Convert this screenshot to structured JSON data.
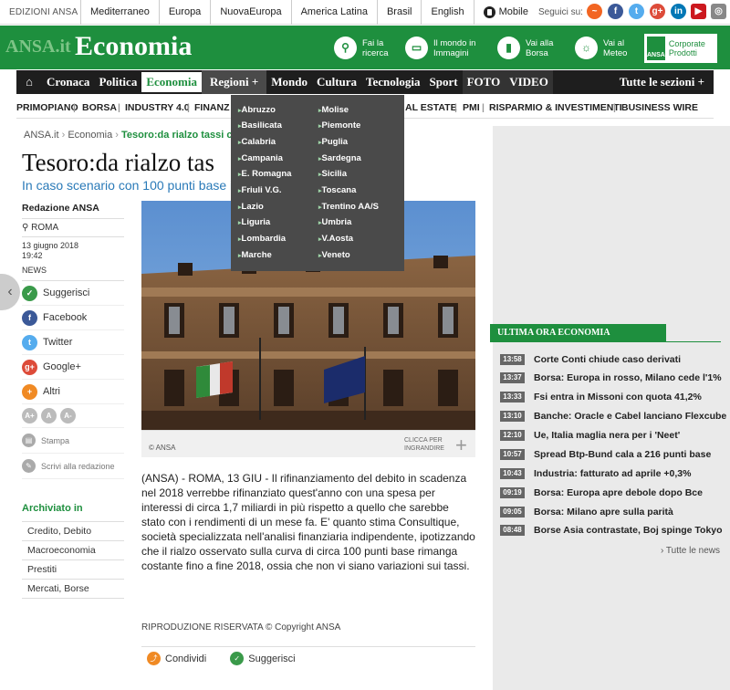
{
  "topbar": {
    "edition": "EDIZIONI ANSA",
    "links": [
      "Mediterraneo",
      "Europa",
      "NuovaEuropa",
      "America Latina",
      "Brasil",
      "English",
      "Mobile"
    ],
    "follow": "Seguici su:"
  },
  "header": {
    "logo_ansa": "ANSA.it",
    "section": "Economia",
    "buttons": [
      {
        "label": "Fai la ricerca",
        "icon": "search-icon"
      },
      {
        "label": "Il mondo in Immagini",
        "icon": "photo-icon"
      },
      {
        "label": "Vai alla Borsa",
        "icon": "chart-icon"
      },
      {
        "label": "Vai al Meteo",
        "icon": "weather-icon"
      }
    ],
    "corporate": "Corporate Prodotti",
    "corporate_logo": "ANSA"
  },
  "nav": {
    "items": [
      "Cronaca",
      "Politica",
      "Economia",
      "Regioni +",
      "Mondo",
      "Cultura",
      "Tecnologia",
      "Sport",
      "FOTO",
      "VIDEO",
      "Tutte le sezioni +"
    ]
  },
  "subnav": [
    "PRIMOPIANO",
    "BORSA",
    "INDUSTRY 4.0",
    "FINANZ",
    "AL ESTATE",
    "PMI",
    "RISPARMIO & INVESTIMENTI",
    "BUSINESS WIRE"
  ],
  "dropdown": {
    "col1": [
      "Abruzzo",
      "Basilicata",
      "Calabria",
      "Campania",
      "E. Romagna",
      "Friuli V.G.",
      "Lazio",
      "Liguria",
      "Lombardia",
      "Marche"
    ],
    "col2": [
      "Molise",
      "Piemonte",
      "Puglia",
      "Sardegna",
      "Sicilia",
      "Toscana",
      "Trentino AA/S",
      "Umbria",
      "V.Aosta",
      "Veneto"
    ]
  },
  "breadcrumb": {
    "home": "ANSA.it",
    "section": "Economia",
    "current": "Tesoro:da rialzo tassi c"
  },
  "article": {
    "title": "Tesoro:da rialzo tas",
    "subtitle": "In caso scenario con 100 punti base i",
    "author": "Redazione ANSA",
    "place": "ROMA",
    "date": "13 giugno 2018",
    "time": "19:42",
    "type": "NEWS",
    "photo_credit": "© ANSA",
    "zoom_label": "CLICCA PER INGRANDIRE",
    "body": "(ANSA) - ROMA, 13 GIU - Il rifinanziamento del debito in scadenza nel 2018 verrebbe rifinanziato quest'anno con una spesa per interessi di circa 1,7 miliardi in più rispetto a quello che sarebbe stato con i rendimenti di un mese fa. E' quanto stima Consultique, società specializzata nell'analisi finanziaria indipendente, ipotizzando che il rialzo osservato sulla curva di circa 100 punti base rimanga costante fino a fine 2018, ossia che non vi siano variazioni sui tassi.",
    "copyright": "RIPRODUZIONE RISERVATA © Copyright ANSA",
    "share_label": "Condividi",
    "suggest_label": "Suggerisci"
  },
  "share": {
    "items": [
      {
        "label": "Suggerisci",
        "icon": "suggest-icon",
        "color": "#3a9a4a"
      },
      {
        "label": "Facebook",
        "icon": "facebook-icon",
        "color": "#3b5998"
      },
      {
        "label": "Twitter",
        "icon": "twitter-icon",
        "color": "#55acee"
      },
      {
        "label": "Google+",
        "icon": "googleplus-icon",
        "color": "#dd4b39"
      },
      {
        "label": "Altri",
        "icon": "plus-icon",
        "color": "#f08a24"
      }
    ],
    "font_sizes": [
      "A+",
      "A",
      "A-"
    ],
    "print": "Stampa",
    "write": "Scrivi alla redazione"
  },
  "archive": {
    "heading": "Archiviato in",
    "items": [
      "Credito, Debito",
      "Macroeconomia",
      "Prestiti",
      "Mercati, Borse"
    ]
  },
  "ultima_ora": {
    "heading": "ULTIMA ORA ECONOMIA",
    "items": [
      {
        "time": "13:58",
        "text": "Corte Conti chiude caso derivati"
      },
      {
        "time": "13:37",
        "text": "Borsa: Europa in rosso, Milano cede l'1%"
      },
      {
        "time": "13:33",
        "text": "Fsi entra in Missoni con quota 41,2%"
      },
      {
        "time": "13:10",
        "text": "Banche: Oracle e Cabel lanciano Flexcube"
      },
      {
        "time": "12:10",
        "text": "Ue, Italia maglia nera per i 'Neet'"
      },
      {
        "time": "10:57",
        "text": "Spread Btp-Bund cala a 216 punti base"
      },
      {
        "time": "10:43",
        "text": "Industria: fatturato ad aprile +0,3%"
      },
      {
        "time": "09:19",
        "text": "Borsa: Europa apre debole dopo Bce"
      },
      {
        "time": "09:05",
        "text": "Borsa: Milano apre sulla parità"
      },
      {
        "time": "08:48",
        "text": "Borse Asia contrastate, Boj spinge Tokyo"
      }
    ],
    "all": "› Tutte le news"
  },
  "colors": {
    "brand_green": "#1e8f3e",
    "nav_dark": "#1e1e1e",
    "link_blue": "#2a7ab8"
  }
}
